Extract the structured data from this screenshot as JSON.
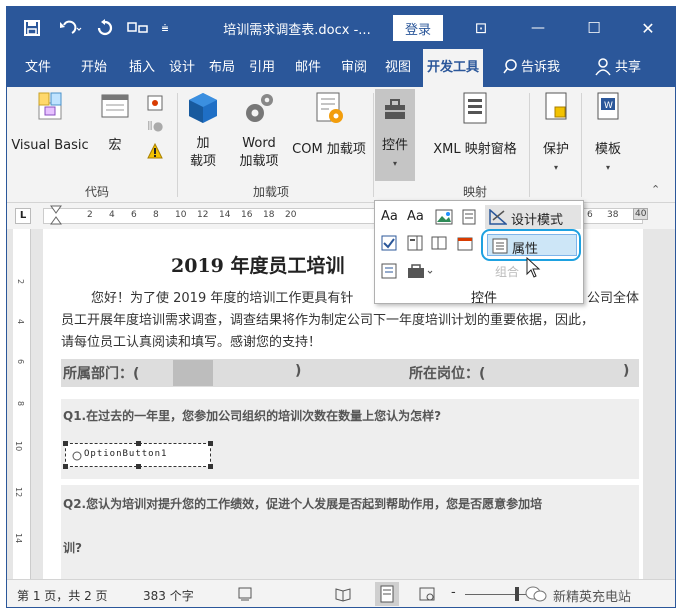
{
  "title_bar": {
    "doc_title": "培训需求调查表.docx -...",
    "login_label": "登录",
    "minimize_glyph": "—",
    "maximize_glyph": "☐",
    "close_glyph": "✕",
    "restore_glyph": "⊡"
  },
  "menu": {
    "tabs": [
      "文件",
      "开始",
      "插入",
      "设计",
      "布局",
      "引用",
      "邮件",
      "审阅",
      "视图",
      "开发工具"
    ],
    "tellme": "告诉我",
    "share": "共享"
  },
  "ribbon": {
    "vb": "Visual Basic",
    "macro": "宏",
    "addins1": "加",
    "addins2": "载项",
    "word_addins1": "Word",
    "word_addins2": "加载项",
    "com_addins": "COM 加载项",
    "controls": "控件",
    "xml_pane": "XML 映射窗格",
    "protect": "保护",
    "template": "模板",
    "group_code": "代码",
    "group_addins": "加载项",
    "group_mapping": "映射"
  },
  "ruler": {
    "corner": "L",
    "ticks": [
      "2",
      "4",
      "6",
      "8",
      "10",
      "12",
      "14",
      "16",
      "18",
      "20"
    ],
    "right_ticks": [
      "6",
      "38",
      "40"
    ]
  },
  "controls_popup": {
    "aa1": "Aa",
    "aa2": "Aa",
    "design_mode": "设计模式",
    "properties": "属性",
    "group": "控件",
    "group_faded": "组合"
  },
  "document": {
    "title": "2019 年度员工培训",
    "para": "您好！为了使 2019 年度的培训工作更具有针",
    "para_right": "公司全体",
    "line2": "员工开展年度培训需求调查，调查结果将作为制定公司下一年度培训计划的重要依据，因此，",
    "line3": "请每位员工认真阅读和填写。感谢您的支持！",
    "dept_label": "所属部门：(",
    "dept_close": ")",
    "post_label": "所在岗位：(",
    "post_close": ")",
    "q1": "Q1.在过去的一年里，您参加公司组织的培训次数在数量上您认为怎样?",
    "option_button": "OptionButton1",
    "q2": "Q2.您认为培训对提升您的工作绩效，促进个人发展是否起到帮助作用，您是否愿意参加培",
    "q2_cont": "训?",
    "vruler_ticks": [
      "2",
      "4",
      "6",
      "8",
      "10",
      "12",
      "14"
    ]
  },
  "status": {
    "page": "第 1 页，共 2 页",
    "words": "383 个字",
    "watermark": "新精英充电站"
  },
  "colors": {
    "word_blue": "#2b579a",
    "highlight_ring": "#1ea1e0"
  }
}
